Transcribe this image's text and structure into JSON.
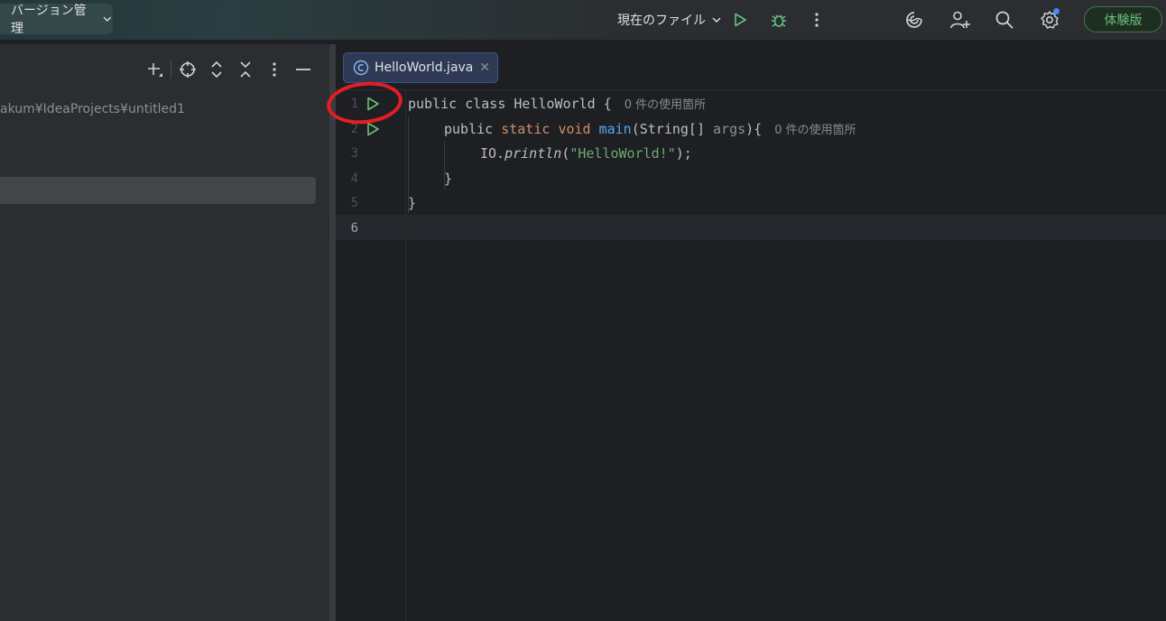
{
  "titlebar": {
    "vcs_label": "バージョン管理",
    "run_config": "現在のファイル",
    "trial_label": "体験版",
    "icons": [
      "chevron-down-icon",
      "run-icon",
      "debug-icon",
      "more-icon",
      "ai-assistant-icon",
      "add-user-icon",
      "search-icon",
      "settings-icon"
    ],
    "colors": {
      "accent_green": "#6ac07a",
      "notify_blue": "#3d8bfd"
    }
  },
  "project_panel": {
    "path_text": "akum¥IdeaProjects¥untitled1",
    "icons": [
      "new-file-icon",
      "locate-icon",
      "expand-all-icon",
      "collapse-all-icon",
      "options-icon",
      "hide-icon"
    ]
  },
  "editor": {
    "tab": {
      "label": "HelloWorld.java",
      "icon": "class-icon",
      "close": "✕"
    },
    "line_numbers": [
      "1",
      "2",
      "3",
      "4",
      "5",
      "6"
    ],
    "active_line": 6,
    "code": {
      "l1": {
        "kw1": "public",
        "kw2": "class",
        "name": "HelloWorld",
        "brace": "{",
        "hint": "0 件の使用箇所"
      },
      "l2": {
        "kw1": "public",
        "kw2": "static",
        "kw3": "void",
        "fn": "main",
        "sig": "(String[] ",
        "param": "args",
        "tail": "){",
        "hint": "0 件の使用箇所"
      },
      "l3": {
        "obj": "IO.",
        "fn": "println",
        "open": "(",
        "str": "\"HelloWorld!\"",
        "close": ");"
      },
      "l4": {
        "text": "}"
      },
      "l5": {
        "text": "}"
      }
    },
    "colors": {
      "keyword": "#cf8e6d",
      "function": "#56a8f5",
      "string": "#6aab73",
      "annotation_circle": "#e31e24"
    }
  }
}
